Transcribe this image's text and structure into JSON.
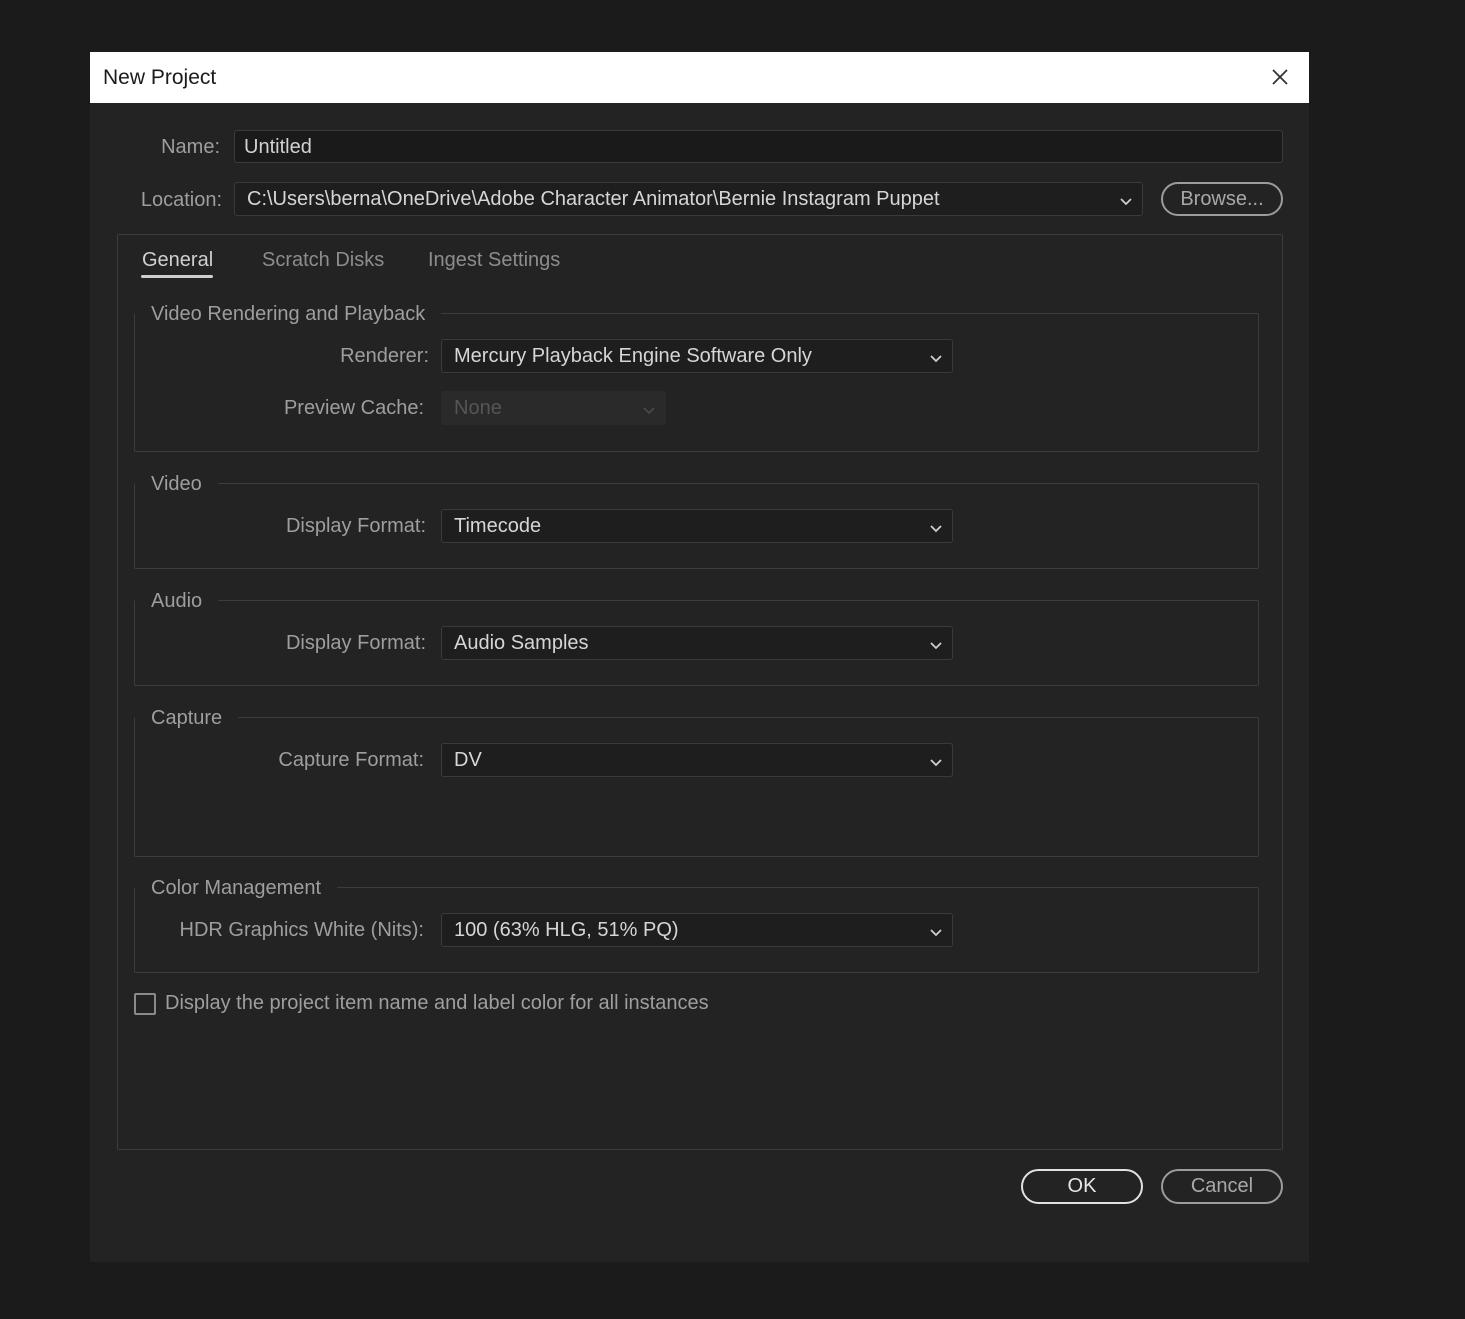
{
  "dialog": {
    "title": "New Project",
    "name_label": "Name:",
    "name_value": "Untitled",
    "location_label": "Location:",
    "location_value": "C:\\Users\\berna\\OneDrive\\Adobe Character Animator\\Bernie Instagram Puppet",
    "browse_label": "Browse...",
    "ok_label": "OK",
    "cancel_label": "Cancel"
  },
  "tabs": [
    {
      "label": "General",
      "active": true
    },
    {
      "label": "Scratch Disks",
      "active": false
    },
    {
      "label": "Ingest Settings",
      "active": false
    }
  ],
  "sections": {
    "video_rendering": {
      "title": "Video Rendering and Playback",
      "renderer_label": "Renderer:",
      "renderer_value": "Mercury Playback Engine Software Only",
      "preview_cache_label": "Preview Cache:",
      "preview_cache_value": "None"
    },
    "video": {
      "title": "Video",
      "display_format_label": "Display Format:",
      "display_format_value": "Timecode"
    },
    "audio": {
      "title": "Audio",
      "display_format_label": "Display Format:",
      "display_format_value": "Audio Samples"
    },
    "capture": {
      "title": "Capture",
      "capture_format_label": "Capture Format:",
      "capture_format_value": "DV"
    },
    "color_management": {
      "title": "Color Management",
      "hdr_label": "HDR Graphics White (Nits):",
      "hdr_value": "100 (63% HLG, 51% PQ)"
    }
  },
  "checkbox": {
    "label": "Display the project item name and label color for all instances",
    "checked": false
  },
  "colors": {
    "background": "#1b1b1b",
    "dialog": "#232323",
    "titlebar": "#ffffff"
  }
}
